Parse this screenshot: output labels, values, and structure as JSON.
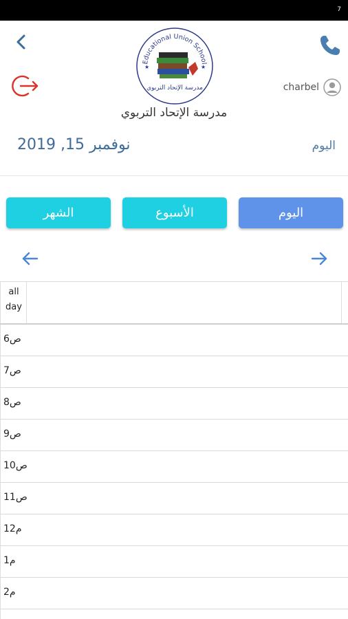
{
  "status_bar": {
    "indicator": "7"
  },
  "header": {
    "back_icon": "chevron-left-icon",
    "phone_icon": "phone-icon",
    "logout_icon": "logout-icon",
    "user_name": "charbel",
    "user_icon": "user-avatar-icon",
    "school_name": "مدرسة الإتحاد التربوي",
    "logo_text_top": "Educational Union School",
    "logo_text_bottom": "مدرسة الإتحاد التربوي",
    "date": "نوفمبر 15, 2019",
    "today_label": "اليوم"
  },
  "view_buttons": {
    "month": "الشهر",
    "week": "الأسبوع",
    "day": "اليوم"
  },
  "calendar": {
    "prev_icon": "arrow-left-icon",
    "next_icon": "arrow-right-icon",
    "allday_line1": "all",
    "allday_line2": "day",
    "hours": [
      "ص6",
      "ص7",
      "ص8",
      "ص9",
      "ص10",
      "ص11",
      "م12",
      "م1",
      "م2"
    ]
  },
  "colors": {
    "accent_blue": "#5f93ea",
    "cyan": "#1fcfe2",
    "date_blue": "#3d6c9a",
    "logout_red": "#d9342b",
    "phone_blue": "#4a7eb0"
  }
}
